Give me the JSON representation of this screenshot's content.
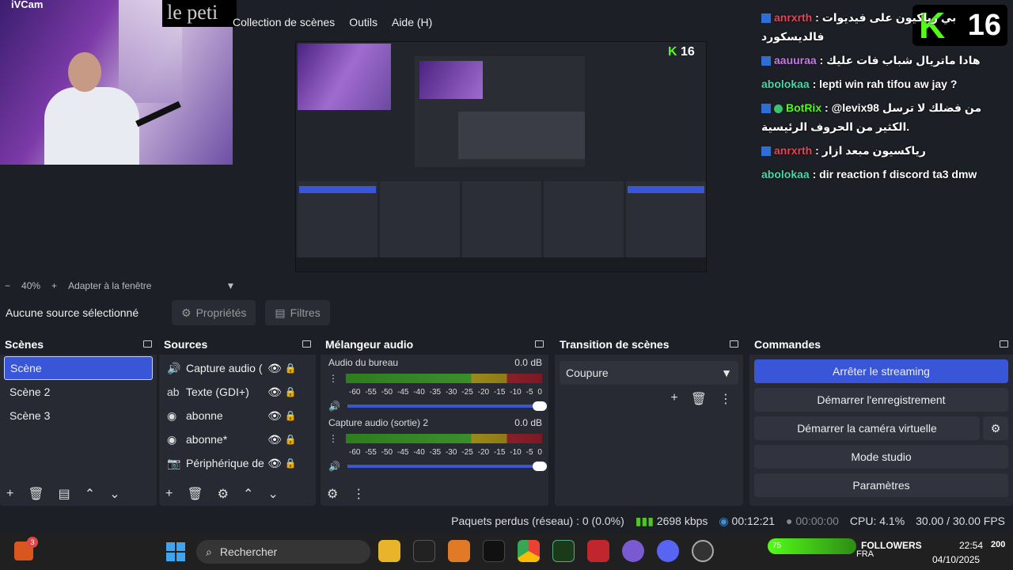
{
  "camera": {
    "title": "iVCam",
    "overlay_text": "le peti"
  },
  "menu": [
    "Collection de scènes",
    "Outils",
    "Aide (H)"
  ],
  "kick_badge": {
    "letter": "K",
    "count": "16"
  },
  "chat": [
    {
      "user": "anrxrth",
      "text": ": بي رياكيون على فيديوات فالديسكورد",
      "color": "#e0485a",
      "kick_icon": true
    },
    {
      "user": "aauuraa",
      "text": ": هادا ماتريال شباب فات عليك",
      "color": "#c77ae6",
      "kick_icon": true
    },
    {
      "user": "abolokaa",
      "text": ": lepti win rah tifou aw jay ?",
      "color": "#4ad6a8",
      "kick_icon": false
    },
    {
      "user": "BotRix",
      "text": ": @levix98 من فضلك لا ترسل الكثير من الحروف الرئيسية.",
      "color": "#53fc18",
      "kick_icon": true,
      "verified": true
    },
    {
      "user": "anrxrth",
      "text": ": رياكسيون مبعد ازار",
      "color": "#e0485a",
      "kick_icon": true
    },
    {
      "user": "abolokaa",
      "text": ": dir reaction f discord ta3 dmw",
      "color": "#4ad6a8",
      "kick_icon": false
    }
  ],
  "zoom": {
    "minus": "−",
    "level": "40%",
    "plus": "+",
    "fit": "Adapter à la fenêtre"
  },
  "source_bar": {
    "none_selected": "Aucune source sélectionné",
    "properties": "Propriétés",
    "filters": "Filtres"
  },
  "scenes": {
    "title": "Scènes",
    "items": [
      "Scène",
      "Scène 2",
      "Scène 3"
    ],
    "active": 0
  },
  "sources": {
    "title": "Sources",
    "items": [
      {
        "icon": "audio-icon",
        "glyph": "🔊",
        "name": "Capture audio ("
      },
      {
        "icon": "text-icon",
        "glyph": "ab",
        "name": "Texte (GDI+)"
      },
      {
        "icon": "browser-icon",
        "glyph": "◉",
        "name": "abonne"
      },
      {
        "icon": "browser-icon",
        "glyph": "◉",
        "name": "abonne*"
      },
      {
        "icon": "camera-icon",
        "glyph": "📷",
        "name": "Périphérique de"
      }
    ]
  },
  "mixer": {
    "title": "Mélangeur audio",
    "channels": [
      {
        "name": "Audio du bureau",
        "db": "0.0 dB",
        "level": 1.0
      },
      {
        "name": "Capture audio (sortie) 2",
        "db": "0.0 dB",
        "level": 1.0
      }
    ],
    "scale": [
      "-60",
      "-55",
      "-50",
      "-45",
      "-40",
      "-35",
      "-30",
      "-25",
      "-20",
      "-15",
      "-10",
      "-5",
      "0"
    ]
  },
  "transitions": {
    "title": "Transition de scènes",
    "selected": "Coupure"
  },
  "commands": {
    "title": "Commandes",
    "stop_streaming": "Arrêter le streaming",
    "start_recording": "Démarrer l'enregistrement",
    "start_virtual_cam": "Démarrer la caméra virtuelle",
    "studio_mode": "Mode studio",
    "settings": "Paramètres"
  },
  "status": {
    "dropped": "Paquets perdus (réseau) : 0 (0.0%)",
    "bitrate": "2698 kbps",
    "stream_time": "00:12:21",
    "rec_time": "00:00:00",
    "cpu": "CPU: 4.1%",
    "fps": "30.00 / 30.00 FPS"
  },
  "taskbar": {
    "notif_count": "3",
    "search": "Rechercher",
    "followers_count": "75",
    "followers_label": "FOLLOWERS",
    "lang": "FRA",
    "time": "22:54",
    "date": "04/10/2025",
    "goal": "200",
    "accent": "#53fc18"
  }
}
